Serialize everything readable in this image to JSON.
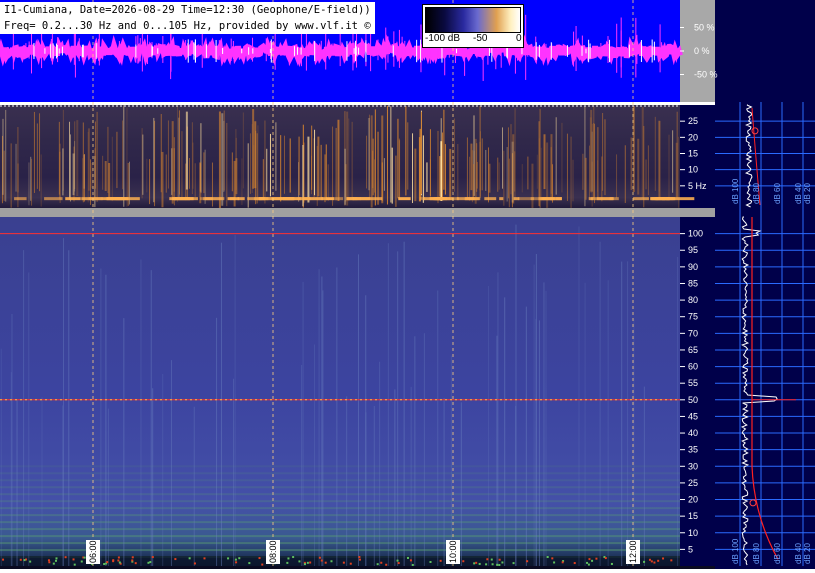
{
  "header": {
    "line1": "I1-Cumiana, Date=2026-08-29 Time=12:30 (Geophone/E-field))",
    "line2": "Freq= 0.2...30 Hz and 0...105 Hz, provided by www.vlf.it ©"
  },
  "colorbar": {
    "labels": [
      "-100 dB",
      "-50",
      "0"
    ]
  },
  "chart_data": [
    {
      "type": "line",
      "panel": "amplitude",
      "y_ticks": [
        "50 %",
        "0 %",
        "-50 %"
      ],
      "ylim": [
        -100,
        100
      ],
      "colors": {
        "background": "#0000ff",
        "signal": "#ff33ff",
        "peak": "#ffffff"
      }
    },
    {
      "type": "heatmap",
      "panel": "spectrogram-low",
      "ylim": [
        0,
        30
      ],
      "y_ticks": [
        "25",
        "20",
        "15",
        "10",
        "5 Hz"
      ],
      "tick_values": [
        25,
        20,
        15,
        10,
        5
      ]
    },
    {
      "type": "heatmap",
      "panel": "spectrogram-high",
      "ylim": [
        0,
        105
      ],
      "y_ticks": [
        "100",
        "95",
        "90",
        "85",
        "80",
        "75",
        "70",
        "65",
        "60",
        "55",
        "50",
        "45",
        "40",
        "35",
        "30",
        "25",
        "20",
        "15",
        "10",
        "5"
      ],
      "tick_values": [
        100,
        95,
        90,
        85,
        80,
        75,
        70,
        65,
        60,
        55,
        50,
        45,
        40,
        35,
        30,
        25,
        20,
        15,
        10,
        5
      ],
      "red_lines_hz": [
        100,
        50
      ]
    },
    {
      "type": "table",
      "panel": "time-axis",
      "time_labels": [
        "06:00",
        "08:00",
        "10:00",
        "12:00"
      ]
    },
    {
      "type": "line",
      "panel": "spectrum-profile",
      "x_ticks": [
        "dB 100",
        "dB 80",
        "dB 60",
        "dB 40",
        "dB 20"
      ],
      "colors": {
        "background": "#00004a",
        "grid": "#2a6aff",
        "profile": "#ffffff",
        "fit": "#ff2020"
      }
    }
  ]
}
